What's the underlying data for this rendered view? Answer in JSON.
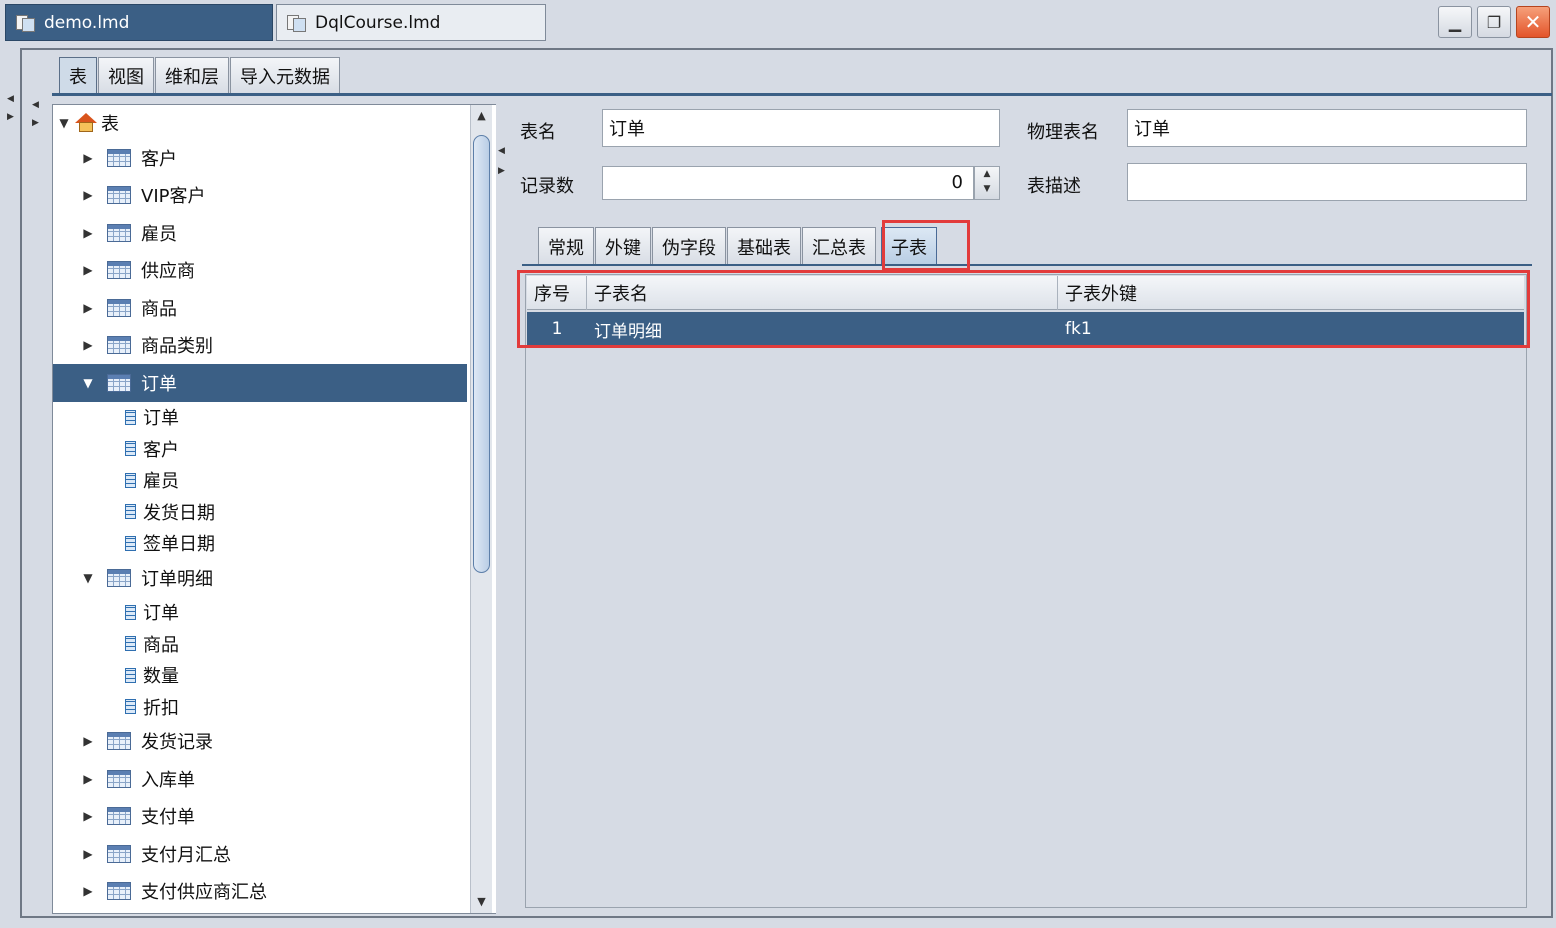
{
  "doc_tabs": [
    {
      "label": "demo.lmd"
    },
    {
      "label": "DqlCourse.lmd"
    }
  ],
  "window_buttons": {
    "minimize": "▁",
    "restore": "❐",
    "close": "✕"
  },
  "top_tabs": [
    "表",
    "视图",
    "维和层",
    "导入元数据"
  ],
  "tree": {
    "root": "表",
    "items": [
      {
        "label": "客户",
        "kind": "table",
        "state": "collapsed"
      },
      {
        "label": "VIP客户",
        "kind": "table",
        "state": "collapsed"
      },
      {
        "label": "雇员",
        "kind": "table",
        "state": "collapsed"
      },
      {
        "label": "供应商",
        "kind": "table",
        "state": "collapsed"
      },
      {
        "label": "商品",
        "kind": "table",
        "state": "collapsed"
      },
      {
        "label": "商品类别",
        "kind": "table",
        "state": "collapsed"
      },
      {
        "label": "订单",
        "kind": "table",
        "state": "expanded",
        "selected": true
      },
      {
        "label": "订单",
        "kind": "field"
      },
      {
        "label": "客户",
        "kind": "field"
      },
      {
        "label": "雇员",
        "kind": "field"
      },
      {
        "label": "发货日期",
        "kind": "field"
      },
      {
        "label": "签单日期",
        "kind": "field"
      },
      {
        "label": "订单明细",
        "kind": "table",
        "state": "expanded"
      },
      {
        "label": "订单",
        "kind": "field"
      },
      {
        "label": "商品",
        "kind": "field"
      },
      {
        "label": "数量",
        "kind": "field"
      },
      {
        "label": "折扣",
        "kind": "field"
      },
      {
        "label": "发货记录",
        "kind": "table",
        "state": "collapsed"
      },
      {
        "label": "入库单",
        "kind": "table",
        "state": "collapsed"
      },
      {
        "label": "支付单",
        "kind": "table",
        "state": "collapsed"
      },
      {
        "label": "支付月汇总",
        "kind": "table",
        "state": "collapsed"
      },
      {
        "label": "支付供应商汇总",
        "kind": "table",
        "state": "collapsed"
      }
    ]
  },
  "form": {
    "table_name_label": "表名",
    "table_name_value": "订单",
    "physical_name_label": "物理表名",
    "physical_name_value": "订单",
    "record_count_label": "记录数",
    "record_count_value": "0",
    "description_label": "表描述",
    "description_value": ""
  },
  "sub_tabs": [
    "常规",
    "外键",
    "伪字段",
    "基础表",
    "汇总表",
    "子表"
  ],
  "active_sub_tab": "子表",
  "subtable_grid": {
    "columns": [
      "序号",
      "子表名",
      "子表外键"
    ],
    "rows": [
      {
        "index": "1",
        "name": "订单明细",
        "fk": "fk1"
      }
    ]
  },
  "colors": {
    "selection": "#3b5f85",
    "highlight_box": "#e23b3b",
    "background": "#d6dbe4"
  }
}
